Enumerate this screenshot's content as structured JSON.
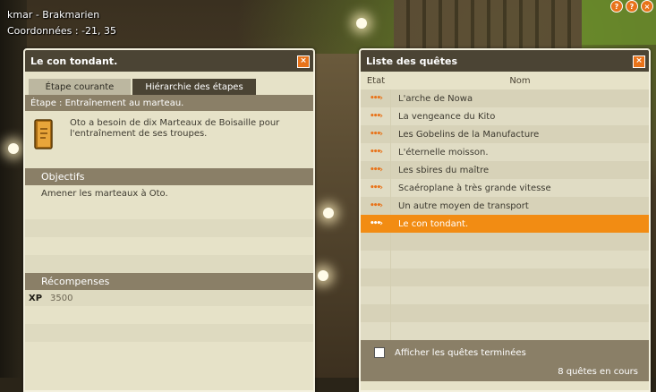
{
  "map": {
    "area": "kmar - Brakmarien",
    "coords": "Coordonnées : -21, 35"
  },
  "top_buttons": [
    "?",
    "?",
    "×"
  ],
  "quest_window": {
    "title": "Le con tondant.",
    "close": "×",
    "tabs": [
      "Étape courante",
      "Hiérarchie des étapes"
    ],
    "step": "Étape : Entraînement au marteau.",
    "description": "Oto a besoin de dix Marteaux de Boisaille pour l'entraînement de ses troupes.",
    "objectives_title": "Objectifs",
    "objectives": [
      "Amener les marteaux à Oto."
    ],
    "rewards_title": "Récompenses",
    "rewards": {
      "xp_label": "XP",
      "xp_value": "3500"
    }
  },
  "list_window": {
    "title": "Liste des quêtes",
    "close": "×",
    "col_state": "Etat",
    "col_name": "Nom",
    "quests": [
      "L'arche de Nowa",
      "La vengeance du Kito",
      "Les Gobelins de la Manufacture",
      "L'éternelle moisson.",
      "Les sbires du maître",
      "Scaéroplane à très grande vitesse",
      "Un autre moyen de transport",
      "Le con tondant."
    ],
    "selected_index": 7,
    "show_finished": "Afficher les quêtes terminées",
    "count": "8 quêtes en cours"
  },
  "colors": {
    "accent": "#f28c13",
    "title_bar": "#4b4434",
    "section_bar": "#8a7f67",
    "panel_bg": "#e6e2c8"
  }
}
